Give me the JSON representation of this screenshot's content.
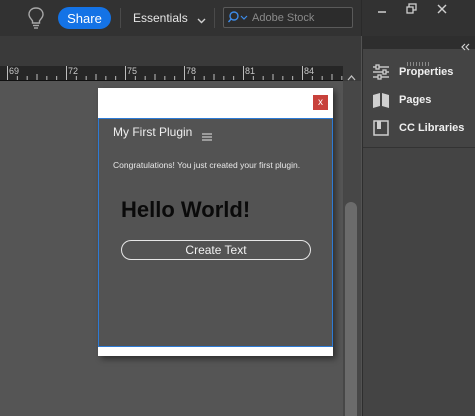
{
  "topbar": {
    "share_label": "Share",
    "workspace_label": "Essentials",
    "stock_placeholder": "Adobe Stock"
  },
  "ruler": {
    "labels": [
      "69",
      "72",
      "75",
      "78",
      "81",
      "84"
    ]
  },
  "right_panel": {
    "items": [
      {
        "label": "Properties",
        "icon": "properties-icon"
      },
      {
        "label": "Pages",
        "icon": "pages-icon"
      },
      {
        "label": "CC Libraries",
        "icon": "cc-libraries-icon"
      }
    ]
  },
  "plugin": {
    "close_label": "x",
    "title": "My First Plugin",
    "message": "Congratulations! You just created your first plugin.",
    "heading": "Hello World!",
    "button_label": "Create Text"
  },
  "colors": {
    "accent": "#1473e6",
    "focus_border": "#2d7bd6",
    "close_button": "#c8413b"
  }
}
